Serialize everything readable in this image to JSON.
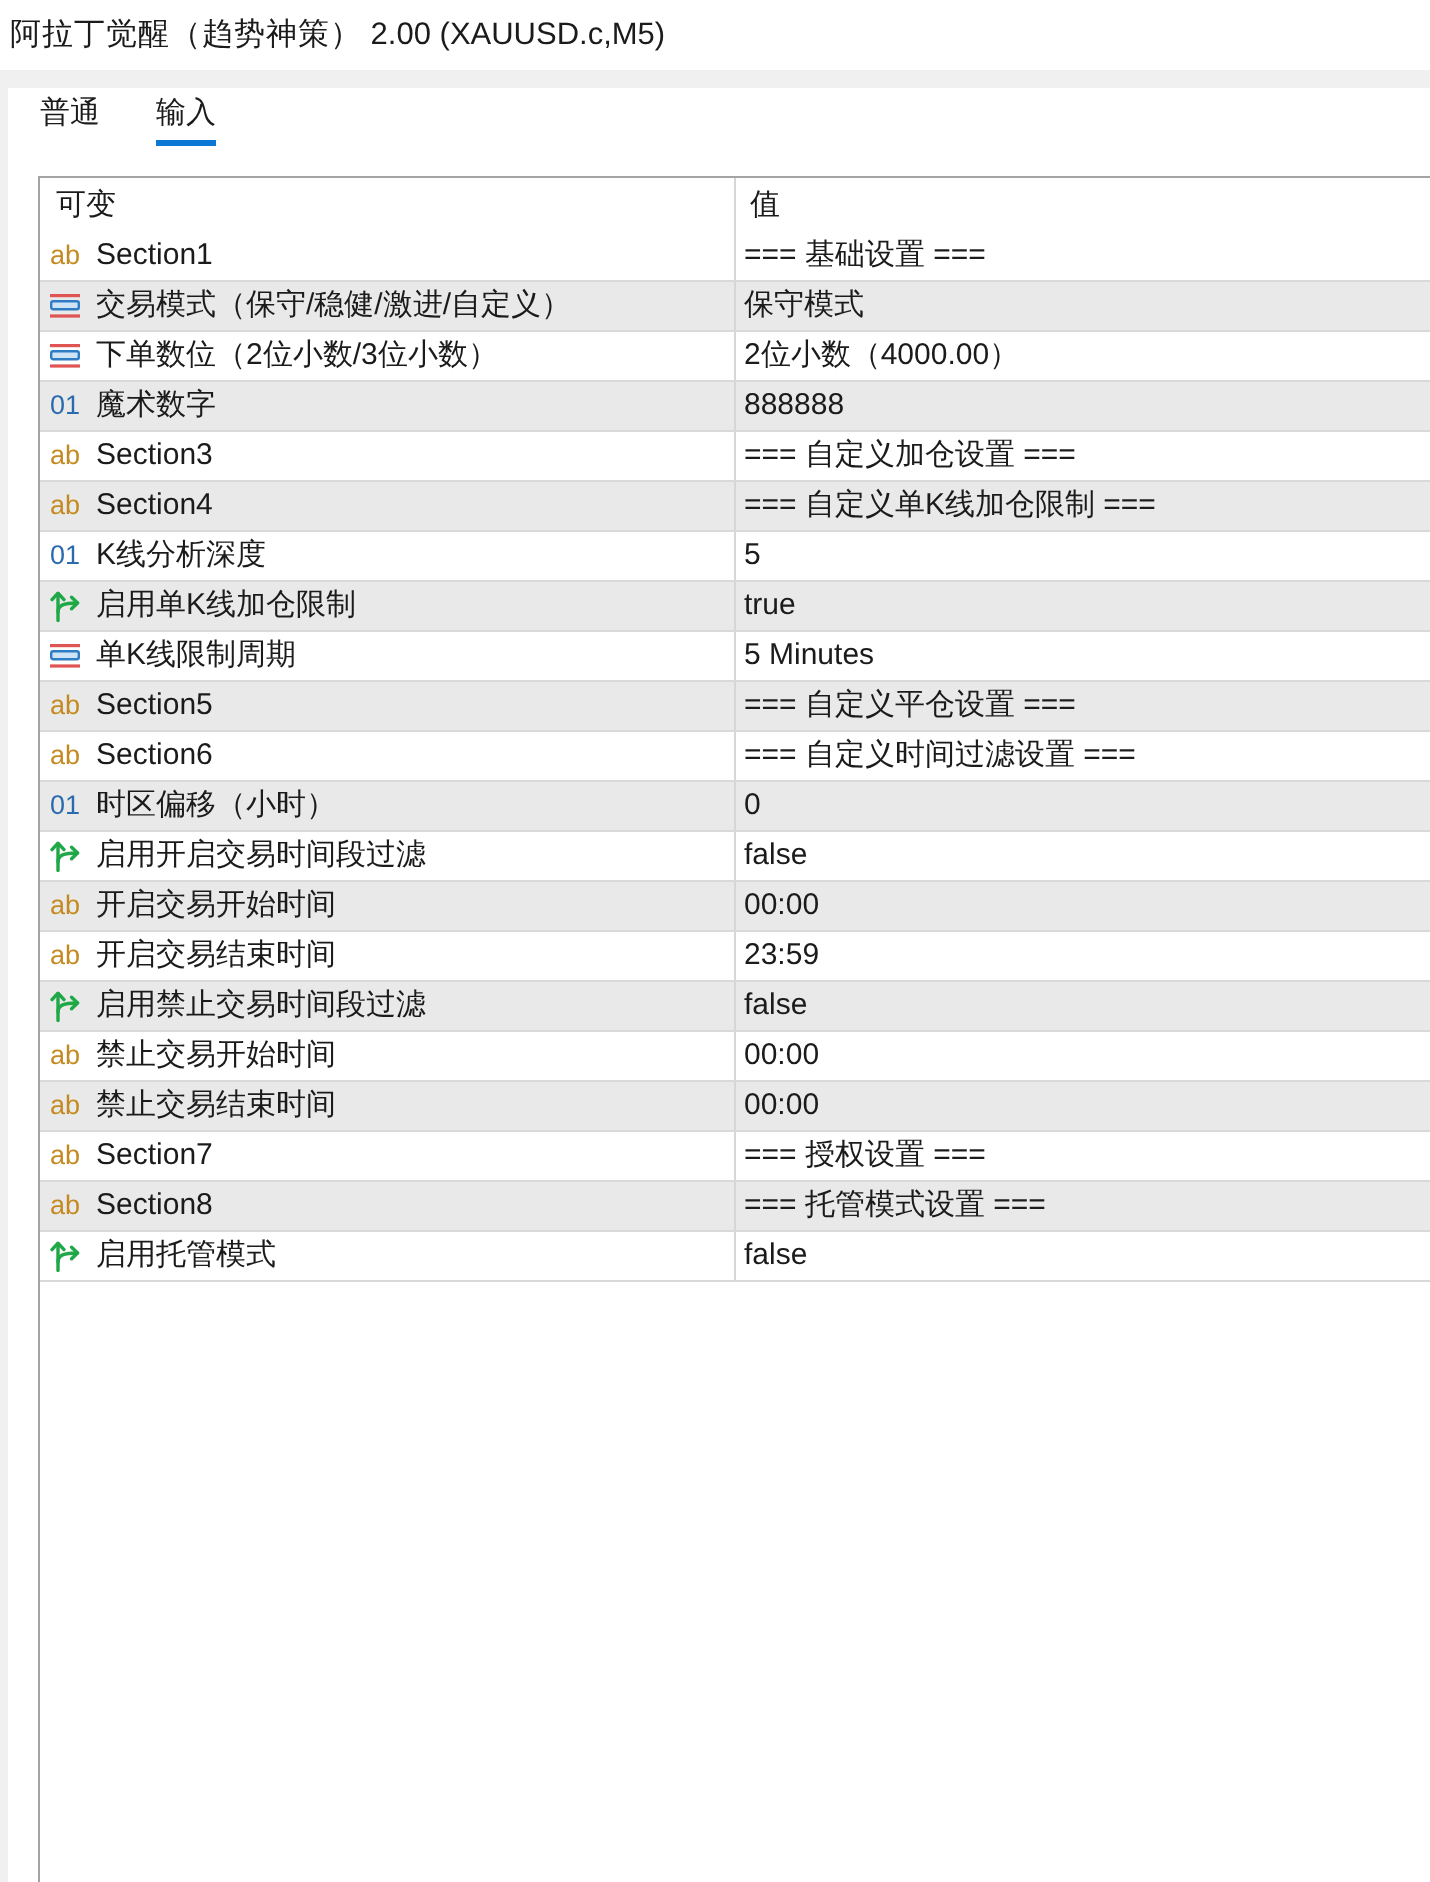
{
  "window": {
    "title": "阿拉丁觉醒（趋势神策） 2.00 (XAUUSD.c,M5)"
  },
  "tabs": [
    {
      "label": "普通",
      "selected": false
    },
    {
      "label": "输入",
      "selected": true
    }
  ],
  "table": {
    "columns": [
      "可变",
      "值"
    ],
    "rows": [
      {
        "kind": "string",
        "icon": "ab",
        "name": "Section1",
        "value": "=== 基础设置 ==="
      },
      {
        "kind": "enum",
        "name": "交易模式（保守/稳健/激进/自定义）",
        "value": "保守模式"
      },
      {
        "kind": "enum",
        "name": "下单数位（2位小数/3位小数）",
        "value": "2位小数（4000.00）"
      },
      {
        "kind": "int",
        "icon": "01",
        "name": "魔术数字",
        "value": "888888"
      },
      {
        "kind": "string",
        "icon": "ab",
        "name": "Section3",
        "value": "=== 自定义加仓设置 ==="
      },
      {
        "kind": "string",
        "icon": "ab",
        "name": "Section4",
        "value": "=== 自定义单K线加仓限制 ==="
      },
      {
        "kind": "int",
        "icon": "01",
        "name": "K线分析深度",
        "value": "5"
      },
      {
        "kind": "bool",
        "name": "启用单K线加仓限制",
        "value": "true"
      },
      {
        "kind": "enum",
        "name": "单K线限制周期",
        "value": "5 Minutes"
      },
      {
        "kind": "string",
        "icon": "ab",
        "name": "Section5",
        "value": "=== 自定义平仓设置 ==="
      },
      {
        "kind": "string",
        "icon": "ab",
        "name": "Section6",
        "value": "=== 自定义时间过滤设置 ==="
      },
      {
        "kind": "int",
        "icon": "01",
        "name": "时区偏移（小时）",
        "value": "0"
      },
      {
        "kind": "bool",
        "name": "启用开启交易时间段过滤",
        "value": "false"
      },
      {
        "kind": "string",
        "icon": "ab",
        "name": "开启交易开始时间",
        "value": "00:00"
      },
      {
        "kind": "string",
        "icon": "ab",
        "name": "开启交易结束时间",
        "value": "23:59"
      },
      {
        "kind": "bool",
        "name": "启用禁止交易时间段过滤",
        "value": "false"
      },
      {
        "kind": "string",
        "icon": "ab",
        "name": "禁止交易开始时间",
        "value": "00:00"
      },
      {
        "kind": "string",
        "icon": "ab",
        "name": "禁止交易结束时间",
        "value": "00:00"
      },
      {
        "kind": "string",
        "icon": "ab",
        "name": "Section7",
        "value": "=== 授权设置 ==="
      },
      {
        "kind": "string",
        "icon": "ab",
        "name": "Section8",
        "value": "=== 托管模式设置 ==="
      },
      {
        "kind": "bool",
        "name": "启用托管模式",
        "value": "false"
      }
    ]
  }
}
